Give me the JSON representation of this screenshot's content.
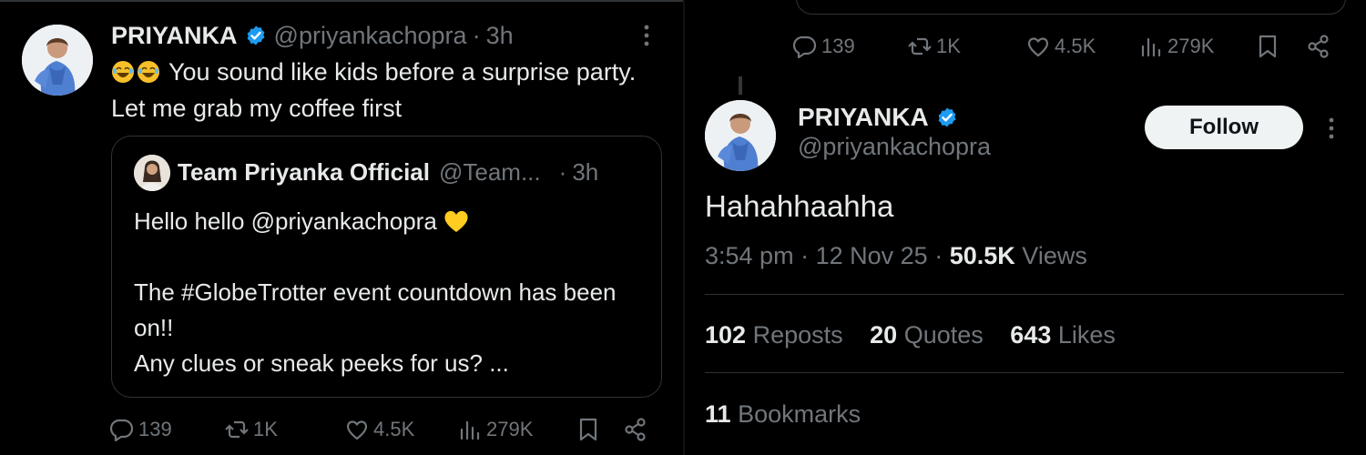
{
  "left_tweet": {
    "author_name": "PRIYANKA",
    "handle": "@priyankachopra",
    "separator": "·",
    "time": "3h",
    "text": "You sound like kids before a surprise party. Let me grab my coffee first",
    "quote": {
      "author_name": "Team Priyanka Official",
      "handle": "@Team...",
      "separator": "·",
      "time": "3h",
      "line1": "Hello hello @priyankachopra",
      "line2": "The #GlobeTrotter event countdown has been on!!",
      "line3": "Any clues or sneak peeks for us? ..."
    },
    "actions": {
      "replies": "139",
      "reposts": "1K",
      "likes": "4.5K",
      "views": "279K"
    }
  },
  "right_tweet": {
    "top_actions": {
      "replies": "139",
      "reposts": "1K",
      "likes": "4.5K",
      "views": "279K"
    },
    "author_name": "PRIYANKA",
    "handle": "@priyankachopra",
    "follow_label": "Follow",
    "text": "Hahahhaahha",
    "time": "3:54 pm",
    "date": "12 Nov 25",
    "separator": "·",
    "views_count": "50.5K",
    "views_label": "Views",
    "reposts_count": "102",
    "reposts_label": "Reposts",
    "quotes_count": "20",
    "quotes_label": "Quotes",
    "likes_count": "643",
    "likes_label": "Likes",
    "bookmarks_count": "11",
    "bookmarks_label": "Bookmarks"
  },
  "colors": {
    "background": "#000000",
    "text": "#e7e9ea",
    "muted": "#71767b",
    "verified": "#1d9bf0",
    "border": "#2f3336"
  }
}
